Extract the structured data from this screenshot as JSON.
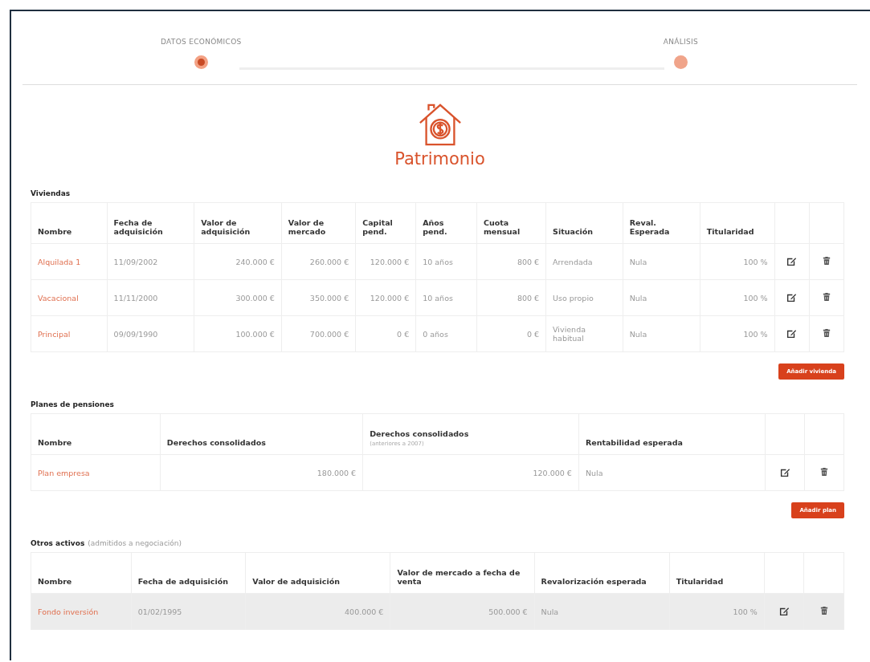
{
  "steps": [
    {
      "label": "DATOS ECONÓMICOS",
      "selected": true
    },
    {
      "label": "ANÁLISIS",
      "selected": false
    }
  ],
  "title": "Patrimonio",
  "sections": [
    {
      "heading": "Viviendas",
      "columns": [
        {
          "label": "Nombre"
        },
        {
          "label": "Fecha de adquisición"
        },
        {
          "label": "Valor de adquisición"
        },
        {
          "label": "Valor de mercado"
        },
        {
          "label": "Capital pend."
        },
        {
          "label": "Años pend."
        },
        {
          "label": "Cuota mensual"
        },
        {
          "label": "Situación"
        },
        {
          "label": "Reval. Esperada"
        },
        {
          "label": "Titularidad"
        }
      ],
      "rows": [
        {
          "selected": false,
          "cells": [
            "Alquilada 1",
            "11/09/2002",
            "240.000 €",
            "260.000 €",
            "120.000 €",
            "10 años",
            "800 €",
            "Arrendada",
            "Nula",
            "100 %"
          ]
        },
        {
          "selected": false,
          "cells": [
            "Vacacional",
            "11/11/2000",
            "300.000 €",
            "350.000 €",
            "120.000 €",
            "10 años",
            "800 €",
            "Uso propio",
            "Nula",
            "100 %"
          ]
        },
        {
          "selected": false,
          "cells": [
            "Principal",
            "09/09/1990",
            "100.000 €",
            "700.000 €",
            "0 €",
            "0 años",
            "0 €",
            "Vivienda habitual",
            "Nula",
            "100 %"
          ]
        }
      ],
      "button": "Añadir vivienda"
    },
    {
      "heading": "Planes de pensiones",
      "columns": [
        {
          "label": "Nombre"
        },
        {
          "label": "Derechos consolidados"
        },
        {
          "label": "Derechos consolidados",
          "note": "(anteriores a 2007)"
        },
        {
          "label": "Rentabilidad esperada"
        }
      ],
      "rows": [
        {
          "selected": false,
          "cells": [
            "Plan empresa",
            "180.000 €",
            "120.000 €",
            "Nula"
          ]
        }
      ],
      "button": "Añadir plan"
    },
    {
      "heading": "Otros activos",
      "heading_note": "(admitidos a negociación)",
      "columns": [
        {
          "label": "Nombre"
        },
        {
          "label": "Fecha de adquisición"
        },
        {
          "label": "Valor de adquisición"
        },
        {
          "label": "Valor de mercado a fecha de venta"
        },
        {
          "label": "Revalorización esperada"
        },
        {
          "label": "Titularidad"
        }
      ],
      "rows": [
        {
          "selected": true,
          "cells": [
            "Fondo inversión",
            "01/02/1995",
            "400.000 €",
            "500.000 €",
            "Nula",
            "100 %"
          ]
        }
      ]
    }
  ]
}
